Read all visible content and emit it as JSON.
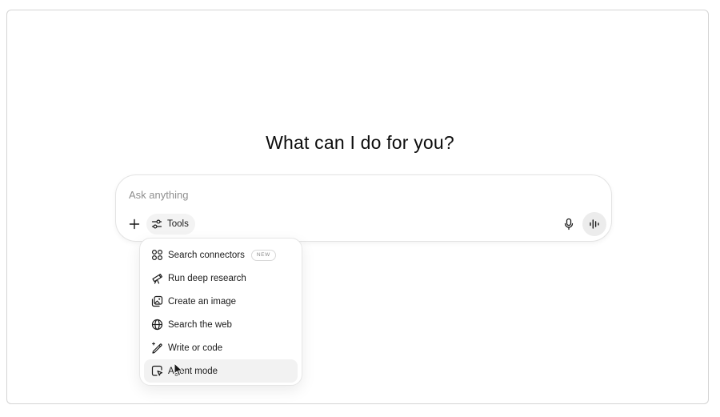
{
  "main": {
    "headline": "What can I do for you?"
  },
  "composer": {
    "placeholder": "Ask anything",
    "value": "",
    "plus_icon": "plus-icon",
    "tools_label": "Tools",
    "tools_icon": "sliders-icon",
    "mic_icon": "microphone-icon",
    "voice_icon": "voice-waveform-icon"
  },
  "tools_menu": {
    "items": [
      {
        "label": "Search connectors",
        "icon": "connectors-icon",
        "badge": "NEW"
      },
      {
        "label": "Run deep research",
        "icon": "telescope-icon"
      },
      {
        "label": "Create an image",
        "icon": "image-icon"
      },
      {
        "label": "Search the web",
        "icon": "globe-icon"
      },
      {
        "label": "Write or code",
        "icon": "pencil-sparkle-icon"
      },
      {
        "label": "Agent mode",
        "icon": "agent-cursor-icon",
        "state": "hovered"
      }
    ]
  }
}
